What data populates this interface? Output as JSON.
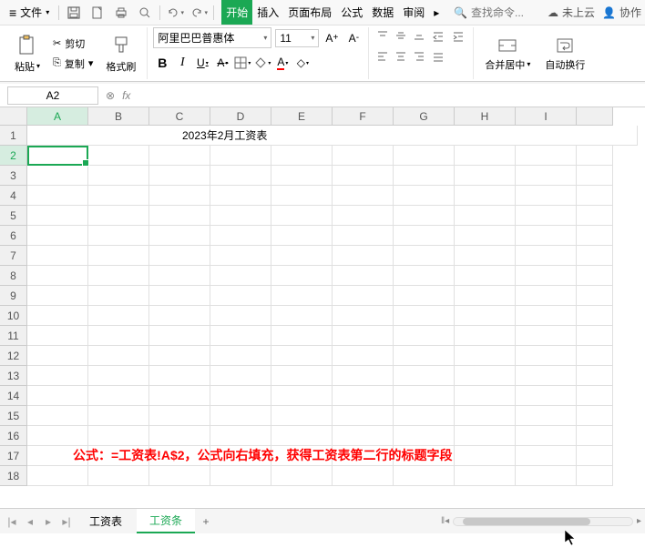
{
  "menubar": {
    "file": "文件",
    "tabs": [
      "开始",
      "插入",
      "页面布局",
      "公式",
      "数据",
      "审阅"
    ],
    "active_tab": 0,
    "search_placeholder": "查找命令...",
    "cloud": "未上云",
    "coop": "协作"
  },
  "ribbon": {
    "paste": "粘贴",
    "cut": "剪切",
    "copy": "复制",
    "format_painter": "格式刷",
    "font_name": "阿里巴巴普惠体",
    "font_size": "11",
    "bold": "B",
    "italic": "I",
    "underline": "U",
    "strike": "A",
    "merge": "合并居中",
    "wrap": "自动换行"
  },
  "formula_bar": {
    "name_box": "A2",
    "fx": "fx",
    "formula": ""
  },
  "columns": [
    "A",
    "B",
    "C",
    "D",
    "E",
    "F",
    "G",
    "H",
    "I"
  ],
  "rows": [
    "1",
    "2",
    "3",
    "4",
    "5",
    "6",
    "7",
    "8",
    "9",
    "10",
    "11",
    "12",
    "13",
    "14",
    "15",
    "16",
    "17",
    "18"
  ],
  "selected_col": 0,
  "selected_row": 1,
  "cells": {
    "title": "2023年2月工资表"
  },
  "annotation": "公式：=工资表!A$2，公式向右填充，获得工资表第二行的标题字段",
  "sheets": {
    "items": [
      "工资表",
      "工资条"
    ],
    "active": 1
  }
}
